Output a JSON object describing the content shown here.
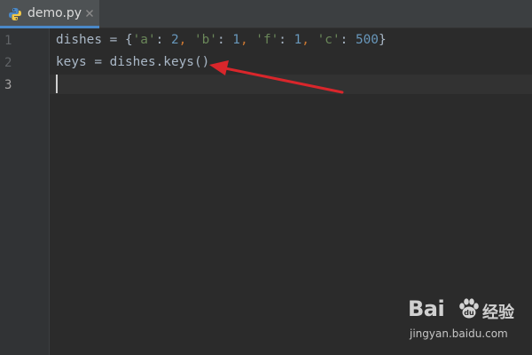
{
  "tab": {
    "filename": "demo.py",
    "icon": "python-file-icon",
    "accent": "#4a88c7"
  },
  "gutter": {
    "line_numbers": [
      "1",
      "2",
      "3"
    ]
  },
  "code": {
    "line1": {
      "text1": "dishes = {",
      "s1": "'a'",
      "c1": ": ",
      "n1": "2",
      "p1": ", ",
      "s2": "'b'",
      "c2": ": ",
      "n2": "1",
      "p2": ", ",
      "s3": "'f'",
      "c3": ": ",
      "n3": "1",
      "p3": ", ",
      "s4": "'c'",
      "c4": ": ",
      "n4": "500",
      "end": "}"
    },
    "line2": "keys = dishes.keys()",
    "line3": ""
  },
  "annotation": {
    "type": "red-arrow",
    "color": "#d9262b"
  },
  "watermark": {
    "brand": "Bai",
    "suffix": "经验",
    "url": "jingyan.baidu.com"
  }
}
